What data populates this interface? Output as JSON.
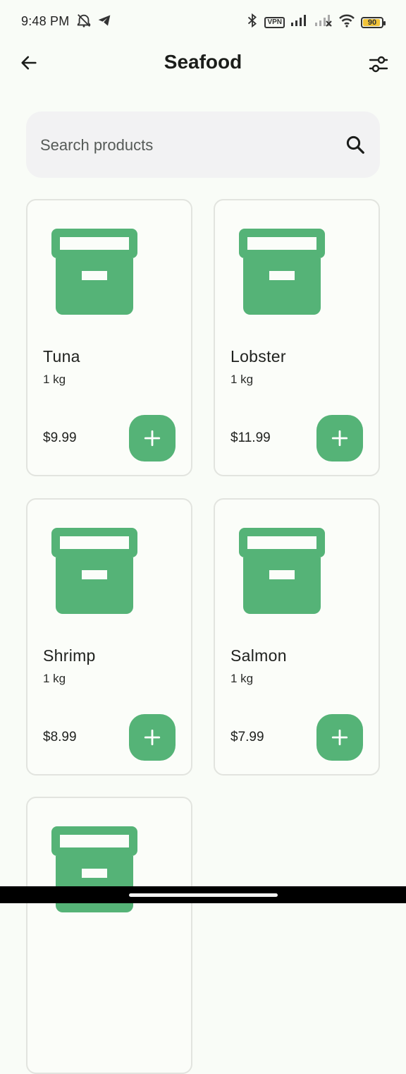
{
  "status_bar": {
    "time": "9:48 PM",
    "vpn_label": "VPN",
    "battery_level": "90",
    "battery_fraction": 0.9
  },
  "header": {
    "title": "Seafood",
    "back_icon": "arrow-left-icon",
    "filter_icon": "sliders-icon"
  },
  "search": {
    "placeholder": "Search products",
    "value": ""
  },
  "colors": {
    "accent": "#55b377",
    "background": "#f9fcf7",
    "card_border": "#e2e4df",
    "search_bg": "#f2f2f3"
  },
  "products": [
    {
      "name": "Tuna",
      "unit": "1 kg",
      "price": "$9.99",
      "icon": "archive-box-icon"
    },
    {
      "name": "Lobster",
      "unit": "1 kg",
      "price": "$11.99",
      "icon": "archive-box-icon"
    },
    {
      "name": "Shrimp",
      "unit": "1 kg",
      "price": "$8.99",
      "icon": "archive-box-icon"
    },
    {
      "name": "Salmon",
      "unit": "1 kg",
      "price": "$7.99",
      "icon": "archive-box-icon"
    },
    {
      "name": "",
      "unit": "",
      "price": "",
      "icon": "archive-box-icon"
    }
  ]
}
